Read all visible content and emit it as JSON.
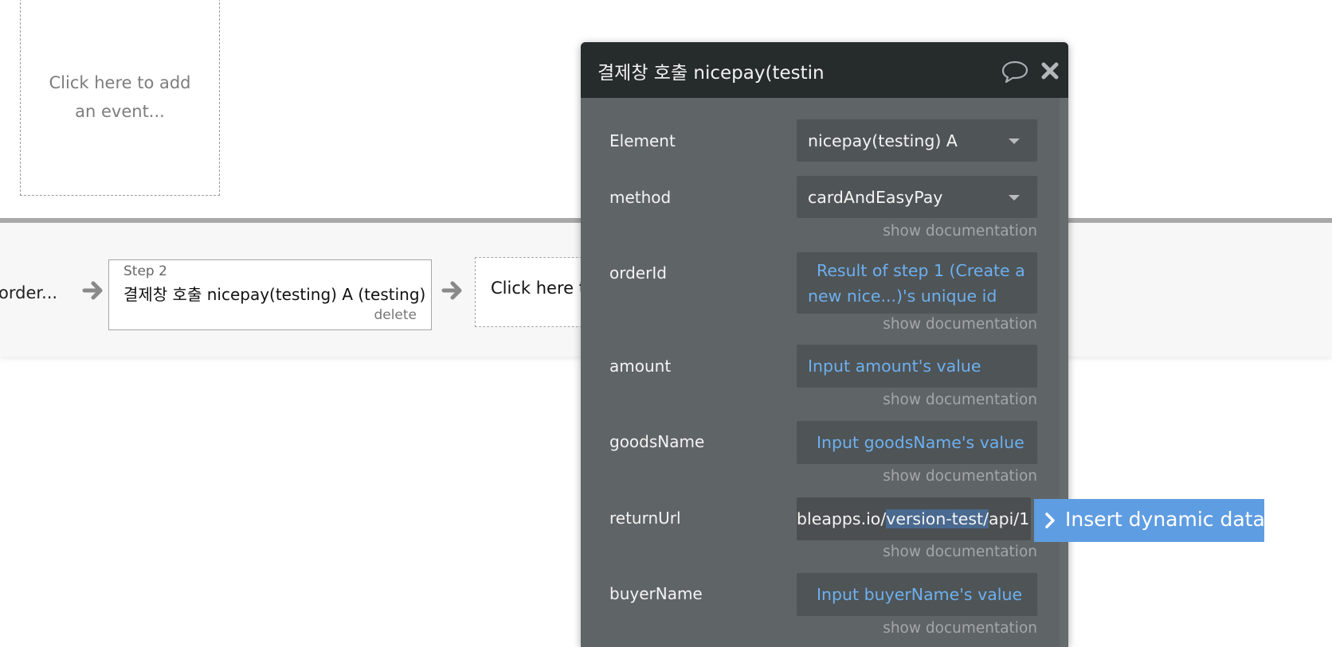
{
  "canvas": {
    "event_placeholder": "Click here to add an event..."
  },
  "workflow": {
    "prev_step_label": "order...",
    "step": {
      "label": "Step 2",
      "title": "결제창 호출 nicepay(testing) A (testing)",
      "delete_label": "delete"
    },
    "add_step_label": "Click here to add an action..."
  },
  "panel": {
    "title": "결제창 호출 nicepay(testin",
    "doc_link": "show documentation",
    "fields": {
      "element": {
        "label": "Element",
        "value": "nicepay(testing) A"
      },
      "method": {
        "label": "method",
        "value": "cardAndEasyPay"
      },
      "orderId": {
        "label": "orderId",
        "line1": "Result of step 1 (Create a",
        "line2": "new nice...)'s unique id"
      },
      "amount": {
        "label": "amount",
        "value": "Input amount's value"
      },
      "goodsName": {
        "label": "goodsName",
        "value": "Input goodsName's value"
      },
      "returnUrl": {
        "label": "returnUrl",
        "pre": "bleapps.io/",
        "sel": "version-test/",
        "post": "api/1"
      },
      "buyerName": {
        "label": "buyerName",
        "value": "Input buyerName's value"
      }
    }
  },
  "insert_dynamic": {
    "label": "Insert dynamic data"
  },
  "icons": [
    "arrow-right-icon",
    "comment-icon",
    "close-icon",
    "caret-down-icon",
    "chevron-right-icon"
  ],
  "colors": {
    "panel_bg": "#5f6466",
    "panel_header": "#262b2c",
    "dynamic_text": "#6db0ef",
    "insert_button": "#5f9de2"
  }
}
